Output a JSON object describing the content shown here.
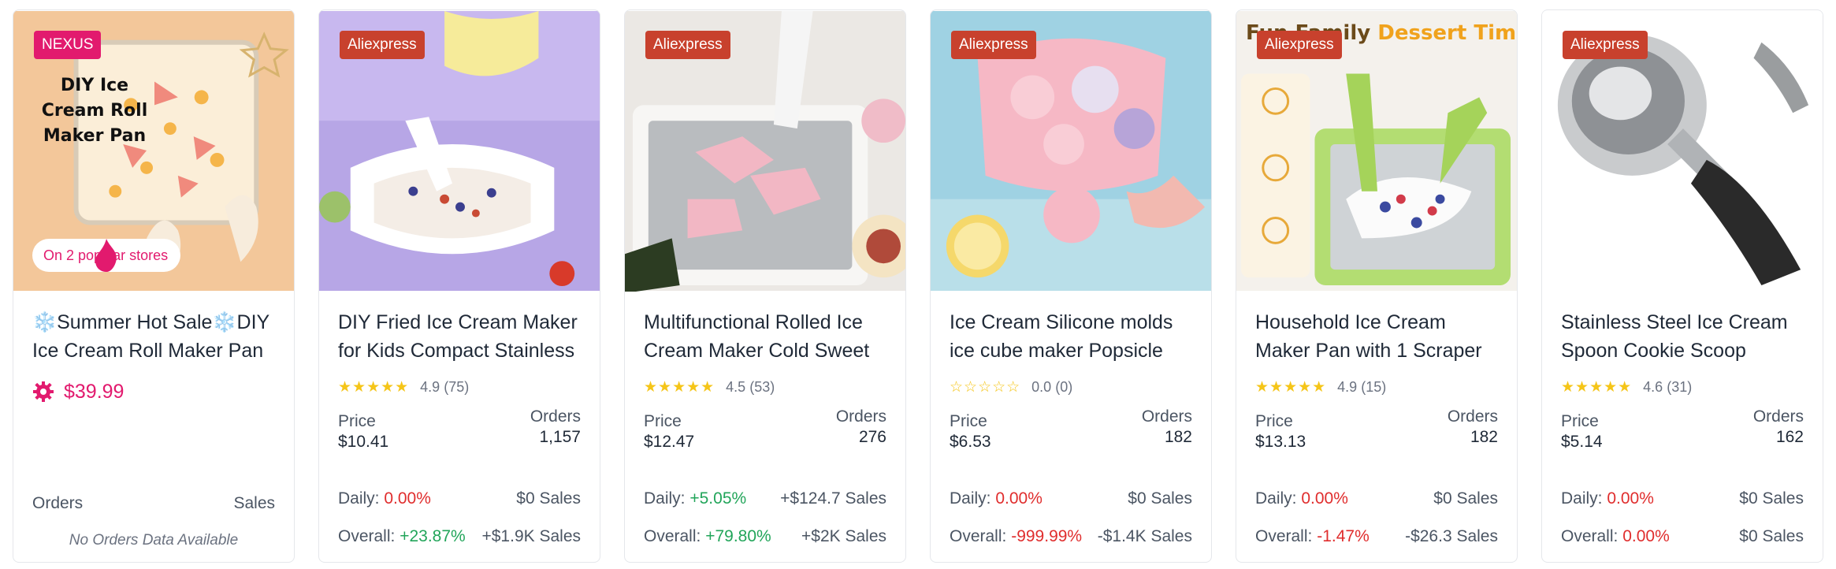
{
  "cards": [
    {
      "badge": "NEXUS",
      "overlay_title": "DIY Ice Cream Roll Maker Pan",
      "popular": "On 2 popular stores",
      "title_line1": "❄️Summer Hot Sale❄️DIY",
      "title_line2": "Ice Cream Roll Maker Pan",
      "price": "$39.99",
      "orders_label": "Orders",
      "sales_label": "Sales",
      "no_data": "No Orders Data Available"
    },
    {
      "badge": "Aliexpress",
      "title_line1": "DIY Fried Ice Cream Maker",
      "title_line2": "for Kids Compact Stainless",
      "stars": "★★★★★",
      "rating": "4.9 (75)",
      "price_label": "Price",
      "price": "$10.41",
      "orders_label": "Orders",
      "orders": "1,157",
      "daily_label": "Daily:",
      "daily_pct": "0.00%",
      "daily_sales": "$0 Sales",
      "overall_label": "Overall:",
      "overall_pct": "+23.87%",
      "overall_sales": "+$1.9K Sales"
    },
    {
      "badge": "Aliexpress",
      "title_line1": "Multifunctional Rolled Ice",
      "title_line2": "Cream Maker Cold Sweet",
      "stars": "★★★★★",
      "rating": "4.5 (53)",
      "price_label": "Price",
      "price": "$12.47",
      "orders_label": "Orders",
      "orders": "276",
      "daily_label": "Daily:",
      "daily_pct": "+5.05%",
      "daily_sales": "+$124.7 Sales",
      "overall_label": "Overall:",
      "overall_pct": "+79.80%",
      "overall_sales": "+$2K Sales"
    },
    {
      "badge": "Aliexpress",
      "title_line1": "Ice Cream Silicone molds",
      "title_line2": "ice cube maker Popsicle",
      "stars": "☆☆☆☆☆",
      "rating": "0.0 (0)",
      "price_label": "Price",
      "price": "$6.53",
      "orders_label": "Orders",
      "orders": "182",
      "daily_label": "Daily:",
      "daily_pct": "0.00%",
      "daily_sales": "$0 Sales",
      "overall_label": "Overall:",
      "overall_pct": "-999.99%",
      "overall_sales": "-$1.4K Sales"
    },
    {
      "badge": "Aliexpress",
      "banner_a": "Fun Family ",
      "banner_b": "Dessert Time",
      "title_line1": "Household Ice Cream",
      "title_line2": "Maker Pan with 1 Scraper",
      "stars": "★★★★★",
      "rating": "4.9 (15)",
      "price_label": "Price",
      "price": "$13.13",
      "orders_label": "Orders",
      "orders": "182",
      "daily_label": "Daily:",
      "daily_pct": "0.00%",
      "daily_sales": "$0 Sales",
      "overall_label": "Overall:",
      "overall_pct": "-1.47%",
      "overall_sales": "-$26.3 Sales"
    },
    {
      "badge": "Aliexpress",
      "title_line1": "Stainless Steel Ice Cream",
      "title_line2": "Spoon Cookie Scoop",
      "stars": "★★★★★",
      "rating": "4.6 (31)",
      "price_label": "Price",
      "price": "$5.14",
      "orders_label": "Orders",
      "orders": "162",
      "daily_label": "Daily:",
      "daily_pct": "0.00%",
      "daily_sales": "$0 Sales",
      "overall_label": "Overall:",
      "overall_pct": "0.00%",
      "overall_sales": "$0 Sales"
    }
  ],
  "colors": {
    "aliexpress_badge": "#c8412d",
    "nexus_badge": "#e21a6e",
    "positive": "#22a55a",
    "negative": "#e02d2d",
    "star": "#f5c518"
  }
}
